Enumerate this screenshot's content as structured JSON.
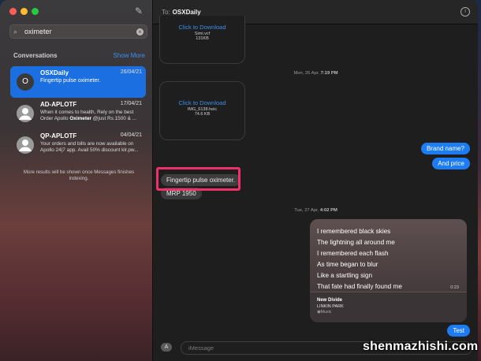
{
  "sidebar": {
    "search": {
      "value": "oximeter",
      "icon": "search-icon"
    },
    "conversations_label": "Conversations",
    "show_more": "Show More",
    "conversations": [
      {
        "avatar": "O",
        "name": "OSXDaily",
        "date": "26/04/21",
        "preview": "Fingertip pulse oximeter.",
        "selected": true
      },
      {
        "avatar": "person-icon",
        "name": "AD-APLOTF",
        "date": "17/04/21",
        "preview_before": "When it comes to health, Rely on the best Order Apollo ",
        "preview_match": "Oximeter",
        "preview_after": " @just Rs.1500 & ..."
      },
      {
        "avatar": "person-icon",
        "name": "QP-APLOTF",
        "date": "04/04/21",
        "preview": "Your orders and bills are now available on Apollo 24|7 app. Avail 50% discount klr.pw..."
      }
    ],
    "hint": "More results will be shown once Messages finishes indexing."
  },
  "chat": {
    "to_label": "To:",
    "recipient": "OSXDaily",
    "attachments": [
      {
        "link": "Click to Download",
        "filename": "Simi.vcf",
        "size": "131KB"
      },
      {
        "link": "Click to Download",
        "filename": "IMG_6138.heic",
        "size": "74.6 KB"
      }
    ],
    "stamp1_day": "Mon, 26 Apr,",
    "stamp1_time": "7:19 PM",
    "msg_brand": "Brand name?",
    "msg_price": "And price",
    "msg_oximeter": "Fingertip pulse oximeter.",
    "msg_mrp": "MRP 1950",
    "stamp2_day": "Tue, 27 Apr,",
    "stamp2_time": "4:02 PM",
    "song": {
      "lyrics": [
        "I remembered black skies",
        "The lightning all around me",
        "I remembered each flash",
        "As time began to blur",
        "Like a startling sign",
        "That fate had finally found me"
      ],
      "duration": "0:23",
      "title": "New Divide",
      "artist": "LINKIN PARK",
      "service": "Music"
    },
    "msg_test": "Test",
    "input_placeholder": "iMessage"
  },
  "watermark": "shenmazhishi.com",
  "colors": {
    "accent": "#1e7cf2",
    "highlight": "#f0306a"
  }
}
